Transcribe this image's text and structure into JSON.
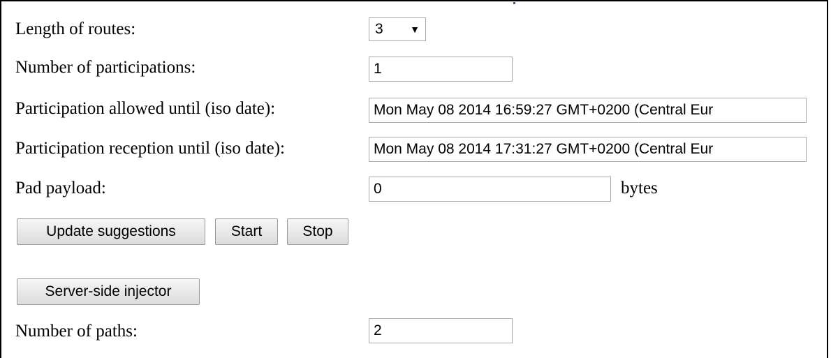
{
  "form": {
    "routes_label": "Length of routes:",
    "routes_value": "3",
    "participations_label": "Number of participations:",
    "participations_value": "1",
    "allowed_label": "Participation allowed until (iso date):",
    "allowed_value": "Mon May 08 2014 16:59:27 GMT+0200 (Central Eur",
    "reception_label": "Participation reception until (iso date):",
    "reception_value": "Mon May 08 2014 17:31:27 GMT+0200 (Central Eur",
    "payload_label": "Pad payload:",
    "payload_value": "0",
    "payload_unit": "bytes",
    "paths_label": "Number of paths:",
    "paths_value": "2"
  },
  "buttons": {
    "update": "Update suggestions",
    "start": "Start",
    "stop": "Stop",
    "injector": "Server-side injector"
  },
  "icons": {
    "select_arrow": "▼"
  }
}
